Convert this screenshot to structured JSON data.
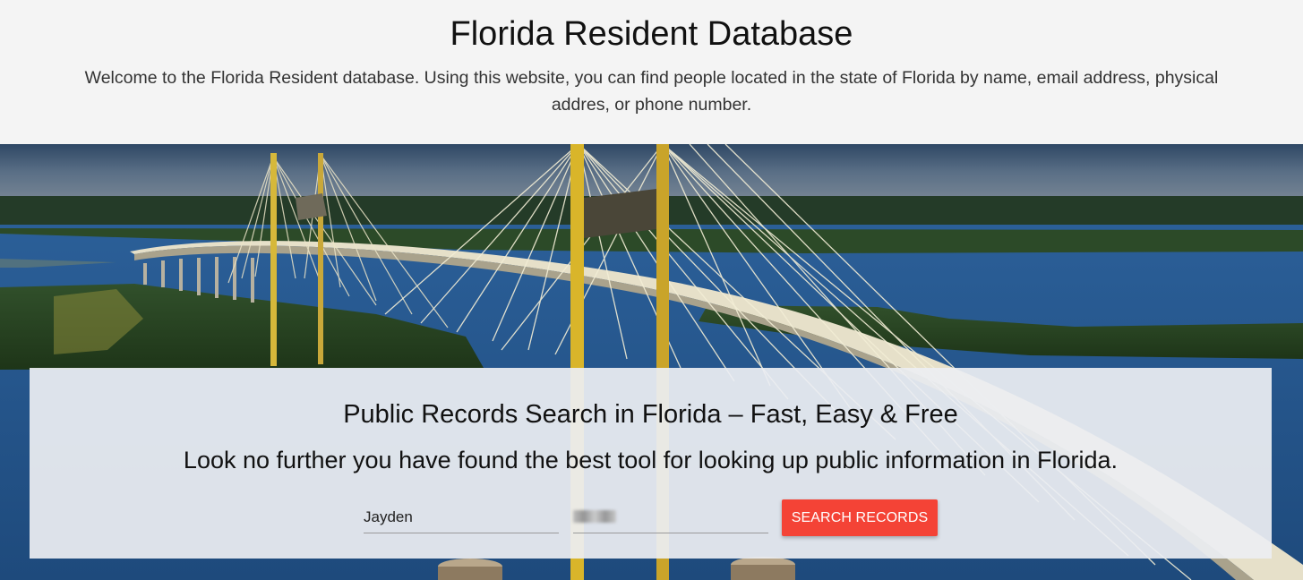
{
  "header": {
    "title": "Florida Resident Database",
    "intro": "Welcome to the Florida Resident database. Using this website, you can find people located in the state of Florida by name, email address, physical addres, or phone number."
  },
  "search_card": {
    "heading": "Public Records Search in Florida – Fast, Easy & Free",
    "subheading": "Look no further you have found the best tool for looking up public information in Florida.",
    "first_name_value": "Jayden",
    "last_name_value": "",
    "button_label": "SEARCH RECORDS"
  },
  "colors": {
    "button": "#f44336",
    "header_background": "#f4f4f4"
  }
}
